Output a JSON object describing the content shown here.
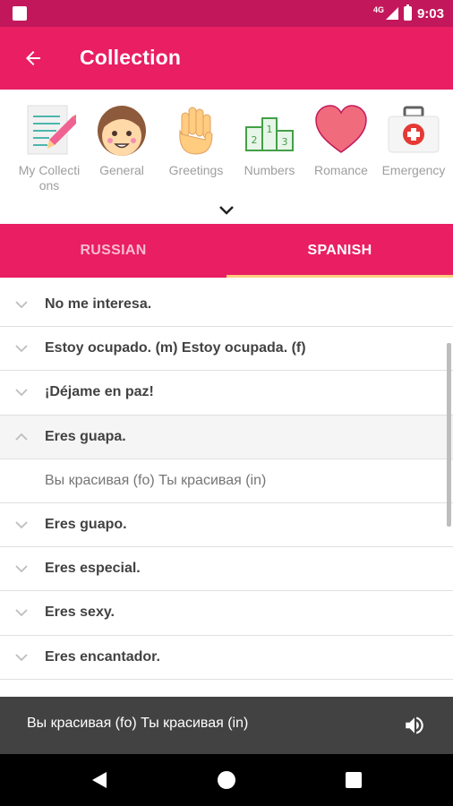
{
  "status_bar": {
    "network": "4G",
    "time": "9:03"
  },
  "app_bar": {
    "title": "Collection",
    "back_icon": "arrow-back-icon"
  },
  "categories": [
    {
      "label": "My Collections",
      "icon": "notebook-pencil-icon"
    },
    {
      "label": "General",
      "icon": "face-icon"
    },
    {
      "label": "Greetings",
      "icon": "waving-hand-icon"
    },
    {
      "label": "Numbers",
      "icon": "podium-icon"
    },
    {
      "label": "Romance",
      "icon": "heart-icon"
    },
    {
      "label": "Emergency",
      "icon": "first-aid-kit-icon"
    }
  ],
  "tabs": [
    {
      "label": "RUSSIAN",
      "selected": false
    },
    {
      "label": "SPANISH",
      "selected": true
    }
  ],
  "phrases": [
    {
      "text": "No me interesa.",
      "expanded": false
    },
    {
      "text": "Estoy ocupado. (m)  Estoy ocupada. (f)",
      "expanded": false
    },
    {
      "text": "¡Déjame en paz!",
      "expanded": false
    },
    {
      "text": "Eres guapa.",
      "expanded": true,
      "translation": "Вы красивая (fo)  Ты красивая (in)"
    },
    {
      "text": "Eres guapo.",
      "expanded": false
    },
    {
      "text": "Eres especial.",
      "expanded": false
    },
    {
      "text": "Eres sexy.",
      "expanded": false
    },
    {
      "text": "Eres encantador.",
      "expanded": false
    }
  ],
  "player": {
    "text": "Вы красивая (fo)  Ты красивая (in)",
    "icon": "volume-icon"
  },
  "colors": {
    "primary": "#e91e63",
    "primary_dark": "#c2185b",
    "tab_indicator": "#ffcc80",
    "player_bg": "#424242"
  }
}
